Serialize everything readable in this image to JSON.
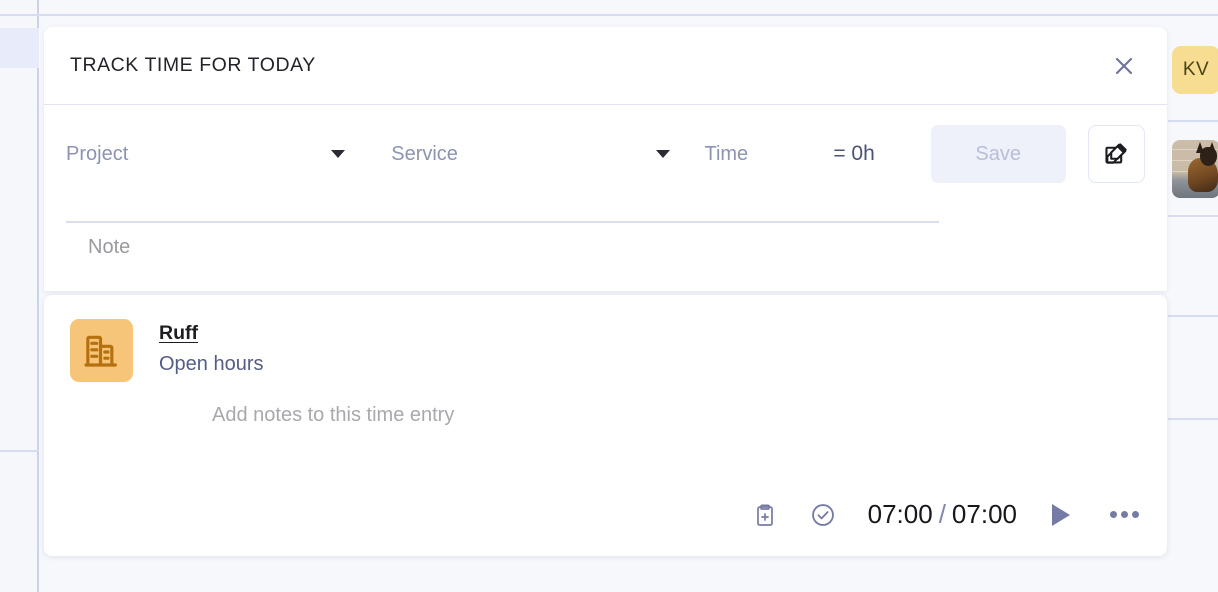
{
  "modal": {
    "title": "TRACK TIME FOR TODAY",
    "close_label": "close-icon",
    "form": {
      "project_placeholder": "Project",
      "service_placeholder": "Service",
      "time_placeholder": "Time",
      "time_total": "= 0h",
      "save_label": "Save",
      "edit_label": "edit-icon",
      "note_placeholder": "Note"
    },
    "entry": {
      "company": "Ruff",
      "service": "Open hours",
      "note_placeholder": "Add notes to this time entry",
      "time_tracked": "07:00",
      "time_total": "07:00",
      "time_separator": "/",
      "copy_icon": "clipboard-plus-icon",
      "approve_icon": "check-circle-icon",
      "play_icon": "play-icon",
      "more_icon": "more-options-icon"
    }
  },
  "background": {
    "avatar_initials": "KV",
    "thumbnail_alt": "dog-photo"
  },
  "colors": {
    "accent": "#757ba4",
    "company_icon_bg": "#f7c579",
    "company_icon_fg": "#b5710f",
    "avatar_bg": "#f6dd92",
    "save_disabled_bg": "#eef0fa",
    "divider": "#dfe3f3"
  }
}
